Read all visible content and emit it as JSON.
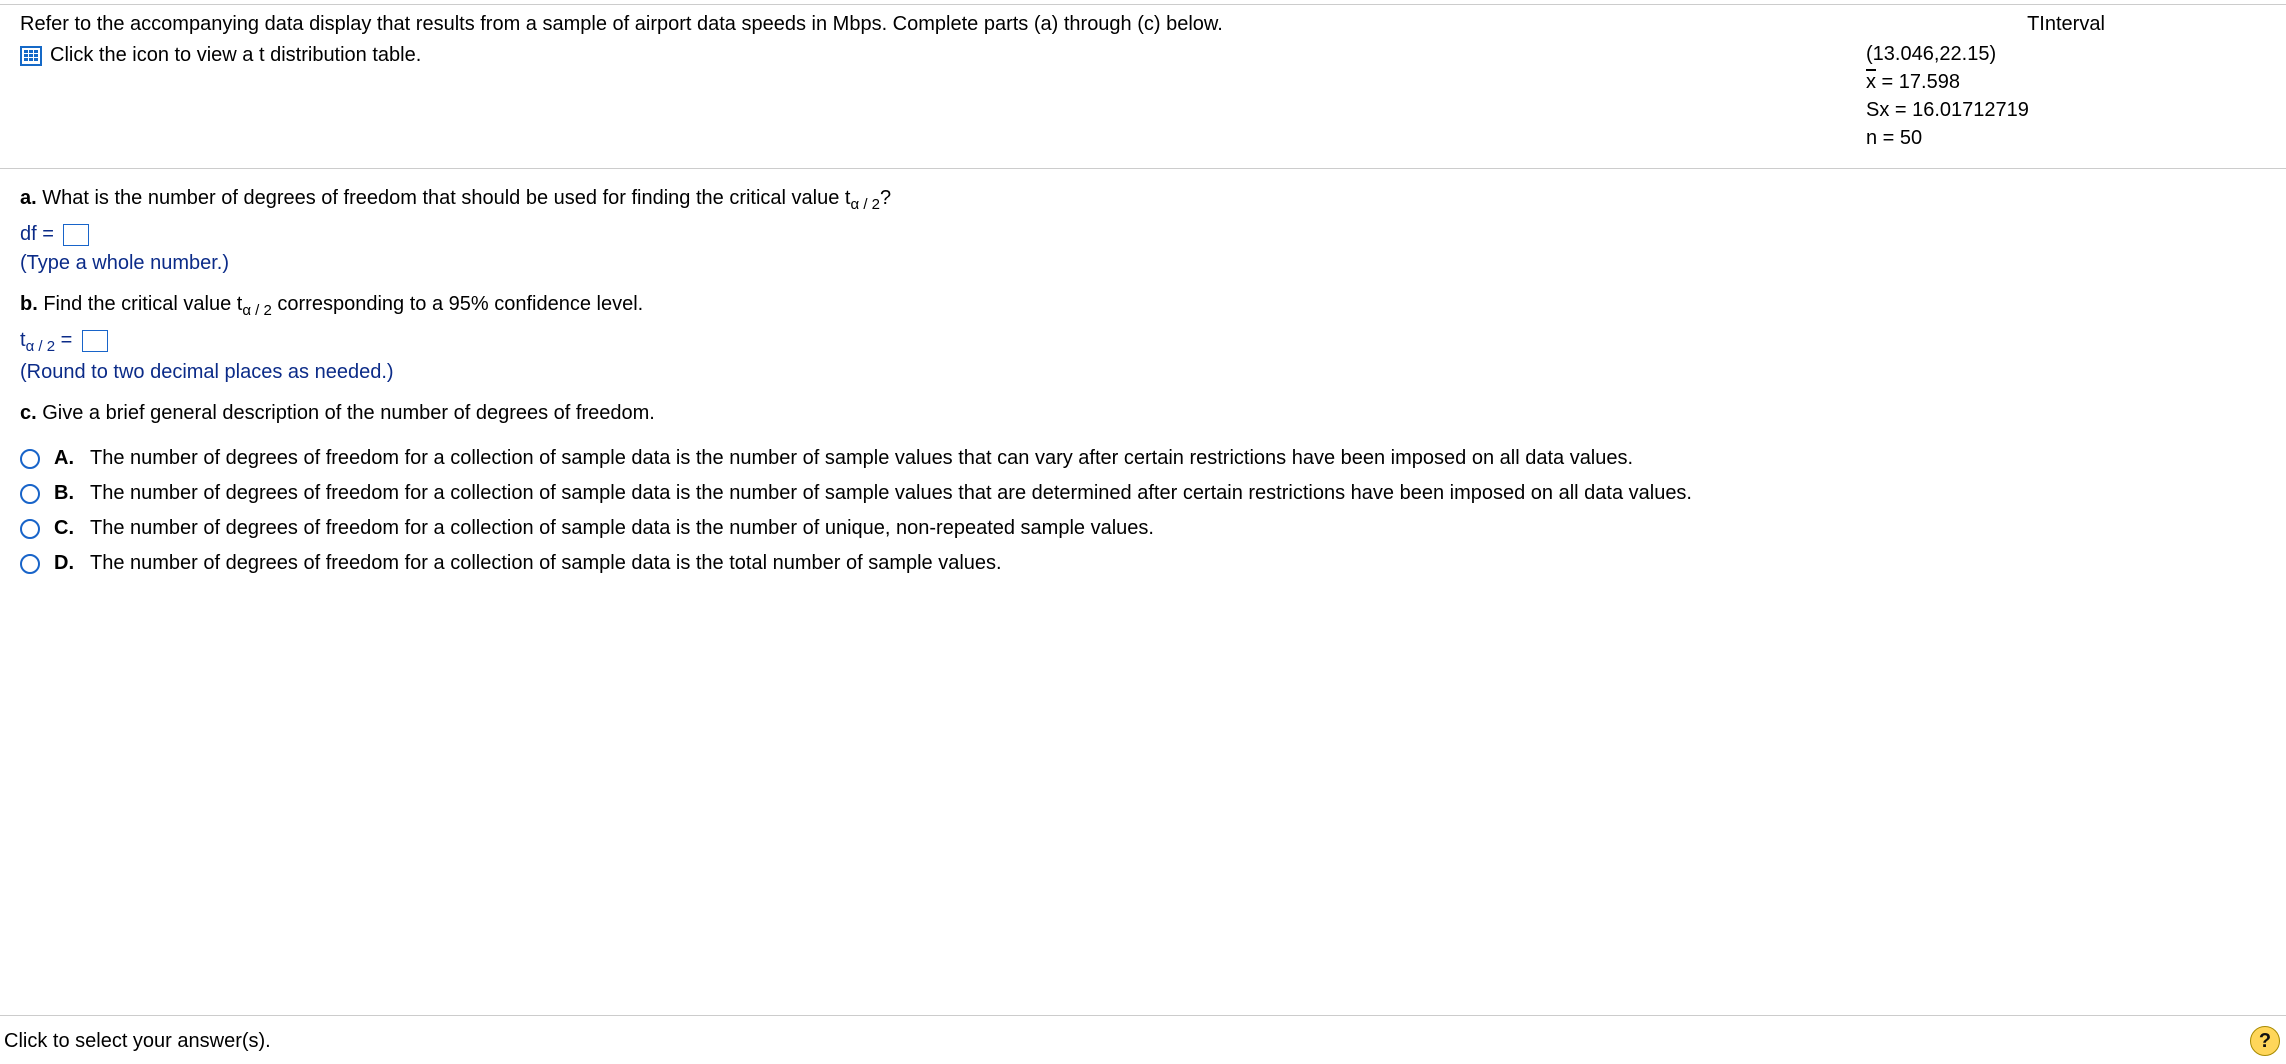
{
  "header": {
    "intro": "Refer to the accompanying data display that results from a sample of airport data speeds in Mbps. Complete parts (a) through (c) below.",
    "icon_link": "Click the icon to view a t distribution table."
  },
  "tinterval": {
    "title": "TInterval",
    "ci": "(13.046,22.15)",
    "xbar_label": "x",
    "xbar_eq": " = 17.598",
    "sx": "Sx = 16.01712719",
    "n": "n = 50"
  },
  "parts": {
    "a": {
      "label": "a.",
      "text_pre": " What is the number of degrees of freedom that should be used for finding the critical value t",
      "text_sub": "α / 2",
      "text_post": "?",
      "answer_label": "df =",
      "hint": "(Type a whole number.)"
    },
    "b": {
      "label": "b.",
      "text_pre": " Find the critical value t",
      "text_sub": "α / 2",
      "text_post": " corresponding to a 95% confidence level.",
      "answer_pre": "t",
      "answer_sub": "α / 2",
      "answer_eq": " =",
      "hint": "(Round to two decimal places as needed.)"
    },
    "c": {
      "label": "c.",
      "text": " Give a brief general description of the number of degrees of freedom."
    }
  },
  "options": [
    {
      "letter": "A.",
      "text": "The number of degrees of freedom for a collection of sample data is the number of sample values that can vary after certain restrictions have been imposed on all data values."
    },
    {
      "letter": "B.",
      "text": "The number of degrees of freedom for a collection of sample data is the number of sample values that are determined after certain restrictions have been imposed on all data values."
    },
    {
      "letter": "C.",
      "text": "The number of degrees of freedom for a collection of sample data is the number of unique, non-repeated sample values."
    },
    {
      "letter": "D.",
      "text": "The number of degrees of freedom for a collection of sample data is the total number of sample values."
    }
  ],
  "footer": {
    "prompt": "Click to select your answer(s).",
    "help": "?"
  }
}
